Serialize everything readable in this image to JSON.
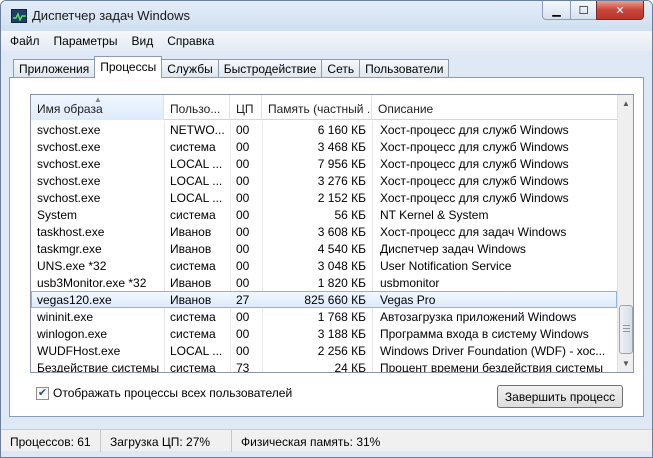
{
  "window": {
    "title": "Диспетчер задач Windows"
  },
  "menu": [
    "Файл",
    "Параметры",
    "Вид",
    "Справка"
  ],
  "tabs": [
    {
      "label": "Приложения",
      "active": false
    },
    {
      "label": "Процессы",
      "active": true
    },
    {
      "label": "Службы",
      "active": false
    },
    {
      "label": "Быстродействие",
      "active": false
    },
    {
      "label": "Сеть",
      "active": false
    },
    {
      "label": "Пользователи",
      "active": false
    }
  ],
  "columns": {
    "name": "Имя образа",
    "user": "Пользо...",
    "cpu": "ЦП",
    "memory": "Память (частный ...",
    "description": "Описание"
  },
  "rows": [
    {
      "name": "svchost.exe",
      "user": "NETWO...",
      "cpu": "00",
      "memory": "6 160 КБ",
      "description": "Хост-процесс для служб Windows"
    },
    {
      "name": "svchost.exe",
      "user": "система",
      "cpu": "00",
      "memory": "3 468 КБ",
      "description": "Хост-процесс для служб Windows"
    },
    {
      "name": "svchost.exe",
      "user": "LOCAL ...",
      "cpu": "00",
      "memory": "7 956 КБ",
      "description": "Хост-процесс для служб Windows"
    },
    {
      "name": "svchost.exe",
      "user": "LOCAL ...",
      "cpu": "00",
      "memory": "3 276 КБ",
      "description": "Хост-процесс для служб Windows"
    },
    {
      "name": "svchost.exe",
      "user": "LOCAL ...",
      "cpu": "00",
      "memory": "2 152 КБ",
      "description": "Хост-процесс для служб Windows"
    },
    {
      "name": "System",
      "user": "система",
      "cpu": "00",
      "memory": "56 КБ",
      "description": "NT Kernel & System"
    },
    {
      "name": "taskhost.exe",
      "user": "Иванов",
      "cpu": "00",
      "memory": "3 608 КБ",
      "description": "Хост-процесс для задач Windows"
    },
    {
      "name": "taskmgr.exe",
      "user": "Иванов",
      "cpu": "00",
      "memory": "4 540 КБ",
      "description": "Диспетчер задач Windows"
    },
    {
      "name": "UNS.exe *32",
      "user": "система",
      "cpu": "00",
      "memory": "3 048 КБ",
      "description": "User Notification Service"
    },
    {
      "name": "usb3Monitor.exe *32",
      "user": "Иванов",
      "cpu": "00",
      "memory": "1 820 КБ",
      "description": "usbmonitor"
    },
    {
      "name": "vegas120.exe",
      "user": "Иванов",
      "cpu": "27",
      "memory": "825 660 КБ",
      "description": "Vegas Pro",
      "selected": true
    },
    {
      "name": "wininit.exe",
      "user": "система",
      "cpu": "00",
      "memory": "1 768 КБ",
      "description": "Автозагрузка приложений Windows"
    },
    {
      "name": "winlogon.exe",
      "user": "система",
      "cpu": "00",
      "memory": "3 188 КБ",
      "description": "Программа входа в систему Windows"
    },
    {
      "name": "WUDFHost.exe",
      "user": "LOCAL ...",
      "cpu": "00",
      "memory": "2 256 КБ",
      "description": "Windows Driver Foundation (WDF) - хос..."
    },
    {
      "name": "Бездействие системы",
      "user": "система",
      "cpu": "73",
      "memory": "24 КБ",
      "description": "Процент времени бездействия системы"
    }
  ],
  "show_all_users": {
    "label": "Отображать процессы всех пользователей",
    "checked": true
  },
  "end_process_button": "Завершить процесс",
  "status": {
    "processes": "Процессов: 61",
    "cpu": "Загрузка ЦП: 27%",
    "memory": "Физическая память: 31%"
  },
  "colors": {
    "selection": "#dbe9fa",
    "window_frame": "#dfe9f5",
    "close_button": "#c8453a"
  }
}
